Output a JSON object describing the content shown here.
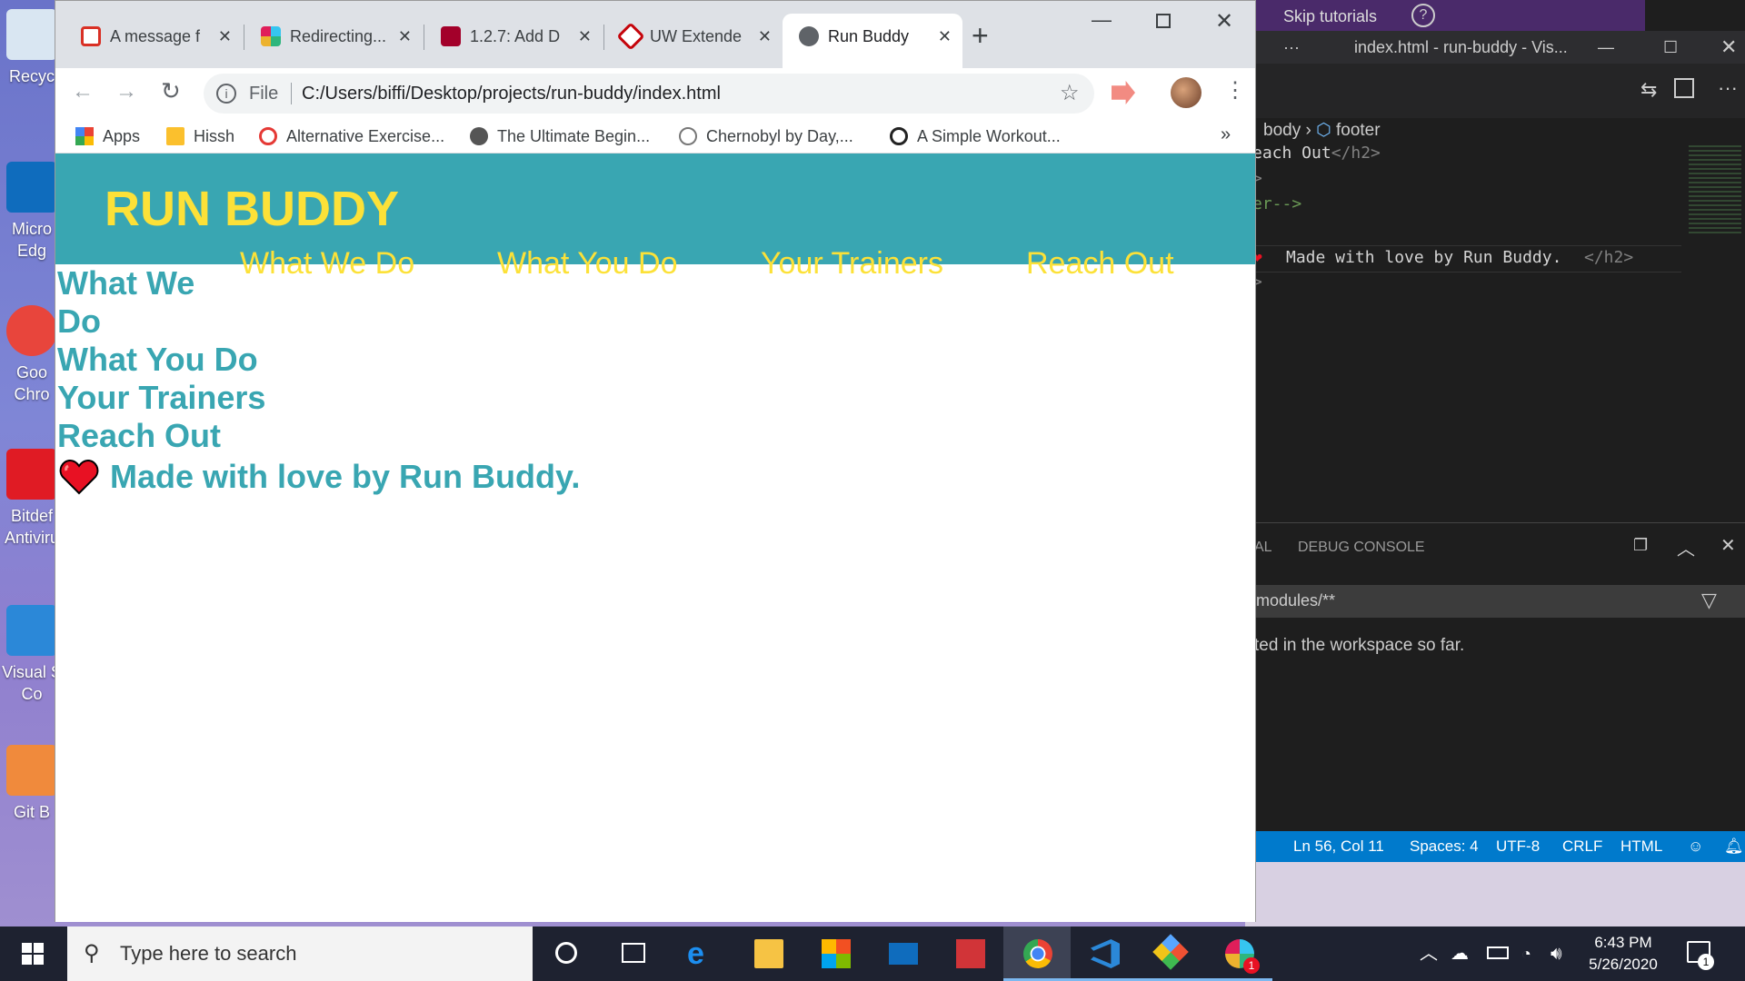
{
  "desktop": {
    "icons": [
      {
        "label": "Recyc",
        "color": "#d9e6f2"
      },
      {
        "label": "Micro Edg",
        "color": "#0f6cbd"
      },
      {
        "label": "Goo Chro",
        "color": "#e8453c"
      },
      {
        "label": "Bitdef Antiviru",
        "color": "#e01b24"
      },
      {
        "label": "Visual S Co",
        "color": "#2b88d8"
      },
      {
        "label": "Git B",
        "color": "#f08a3c"
      }
    ]
  },
  "vscode": {
    "top_right": "Skip tutorials",
    "title": "index.html - run-buddy - Vis...",
    "breadcrumb": {
      "first": "body",
      "second": "footer"
    },
    "code": {
      "line1_text": "each Out",
      "line1_close": "</h2>",
      "line2": ">",
      "line3": "er-->",
      "line4_text": "Made with love by Run Buddy.",
      "line4_close": "</h2>",
      "line5": ">"
    },
    "panel": {
      "tab_partial": "AL",
      "tab_debug": "DEBUG CONSOLE",
      "filter_value": "modules/**",
      "message": "ted in the workspace so far."
    },
    "status": {
      "position": "Ln 56, Col 11",
      "spaces": "Spaces: 4",
      "encoding": "UTF-8",
      "eol": "CRLF",
      "language": "HTML"
    }
  },
  "browser": {
    "tabs": [
      {
        "title": "A message f",
        "favicon": "gmail-icon",
        "color": "#d93025"
      },
      {
        "title": "Redirecting...",
        "favicon": "slack-icon",
        "color": "#4a154b"
      },
      {
        "title": "1.2.7: Add D",
        "favicon": "canvas-icon",
        "color": "#a3002a"
      },
      {
        "title": "UW Extende",
        "favicon": "uw-icon",
        "color": "#c5050c"
      },
      {
        "title": "Run Buddy",
        "favicon": "globe-icon",
        "color": "#5f6368"
      }
    ],
    "address": {
      "scheme_label": "File",
      "url": "C:/Users/biffi/Desktop/projects/run-buddy/index.html"
    },
    "bookmarks": [
      {
        "label": "Apps",
        "color": "#4285f4"
      },
      {
        "label": "Hissh",
        "color": "#fbc02d"
      },
      {
        "label": "Alternative Exercise...",
        "color": "#e53935"
      },
      {
        "label": "The Ultimate Begin...",
        "color": "#555555"
      },
      {
        "label": "Chernobyl by Day,...",
        "color": "#777777"
      },
      {
        "label": "A Simple Workout...",
        "color": "#222222"
      }
    ],
    "more_bookmarks": "»"
  },
  "page": {
    "logo": "RUN BUDDY",
    "nav": [
      "What We Do",
      "What You Do",
      "Your Trainers",
      "Reach Out"
    ],
    "headings": [
      "What We",
      "Do",
      "What You Do",
      "Your Trainers",
      "Reach Out"
    ],
    "footer": "Made with love by Run Buddy.",
    "colors": {
      "primary": "#39a6b2",
      "accent": "#fce138"
    }
  },
  "taskbar": {
    "search_placeholder": "Type here to search",
    "time": "6:43 PM",
    "date": "5/26/2020",
    "notification_count": "1",
    "slack_badge": "1"
  }
}
